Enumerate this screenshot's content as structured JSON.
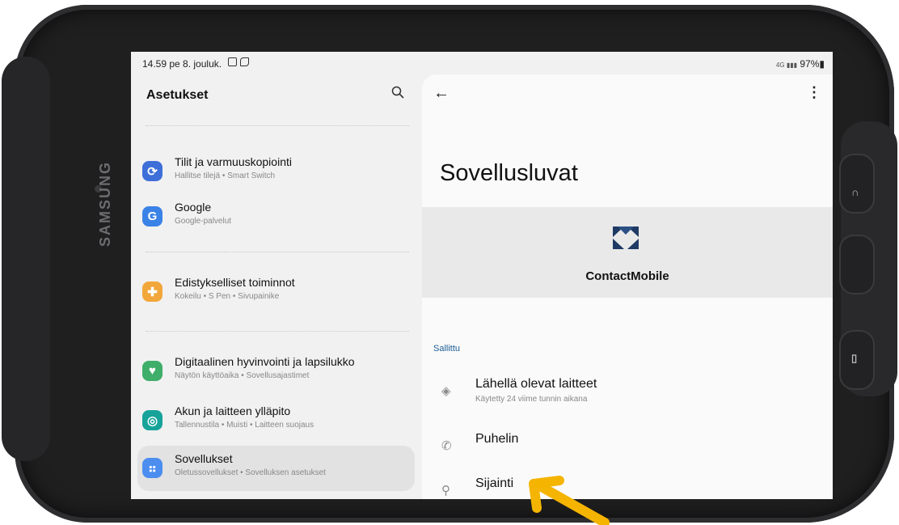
{
  "device": {
    "brand": "SAMSUNG"
  },
  "status": {
    "time": "14.59 pe 8. jouluk.",
    "right": "97%▮",
    "signal": "4G ▮▮▮"
  },
  "left_panel": {
    "title": "Asetukset",
    "items": [
      {
        "title": "Tilit ja varmuuskopiointi",
        "subtitle": "Hallitse tilejä • Smart Switch",
        "icon": "sync-icon",
        "color": "#3e6fd9"
      },
      {
        "title": "Google",
        "subtitle": "Google-palvelut",
        "icon": "google-icon",
        "color": "#3b82e6"
      },
      {
        "title": "Edistykselliset toiminnot",
        "subtitle": "Kokeilu • S Pen • Sivupainike",
        "icon": "gear-plus-icon",
        "color": "#f2a73b"
      },
      {
        "title": "Digitaalinen hyvinvointi ja lapsilukko",
        "subtitle": "Näytön käyttöaika • Sovellusajastimet",
        "icon": "wellbeing-icon",
        "color": "#3fae6a"
      },
      {
        "title": "Akun ja laitteen ylläpito",
        "subtitle": "Tallennustila • Muisti • Laitteen suojaus",
        "icon": "device-care-icon",
        "color": "#17a39a"
      },
      {
        "title": "Sovellukset",
        "subtitle": "Oletussovellukset • Sovelluksen asetukset",
        "icon": "apps-icon",
        "color": "#4c8ef0"
      }
    ]
  },
  "right_panel": {
    "title": "Sovellusluvat",
    "app_name": "ContactMobile",
    "section": "Sallittu",
    "permissions": [
      {
        "title": "Lähellä olevat laitteet",
        "subtitle": "Käytetty 24 viime tunnin aikana",
        "icon": "nearby-devices-icon"
      },
      {
        "title": "Puhelin",
        "subtitle": "",
        "icon": "phone-icon"
      },
      {
        "title": "Sijainti",
        "subtitle": "",
        "icon": "location-icon"
      }
    ]
  },
  "colors": {
    "accent": "#1d5e98",
    "arrow": "#f5b400"
  }
}
